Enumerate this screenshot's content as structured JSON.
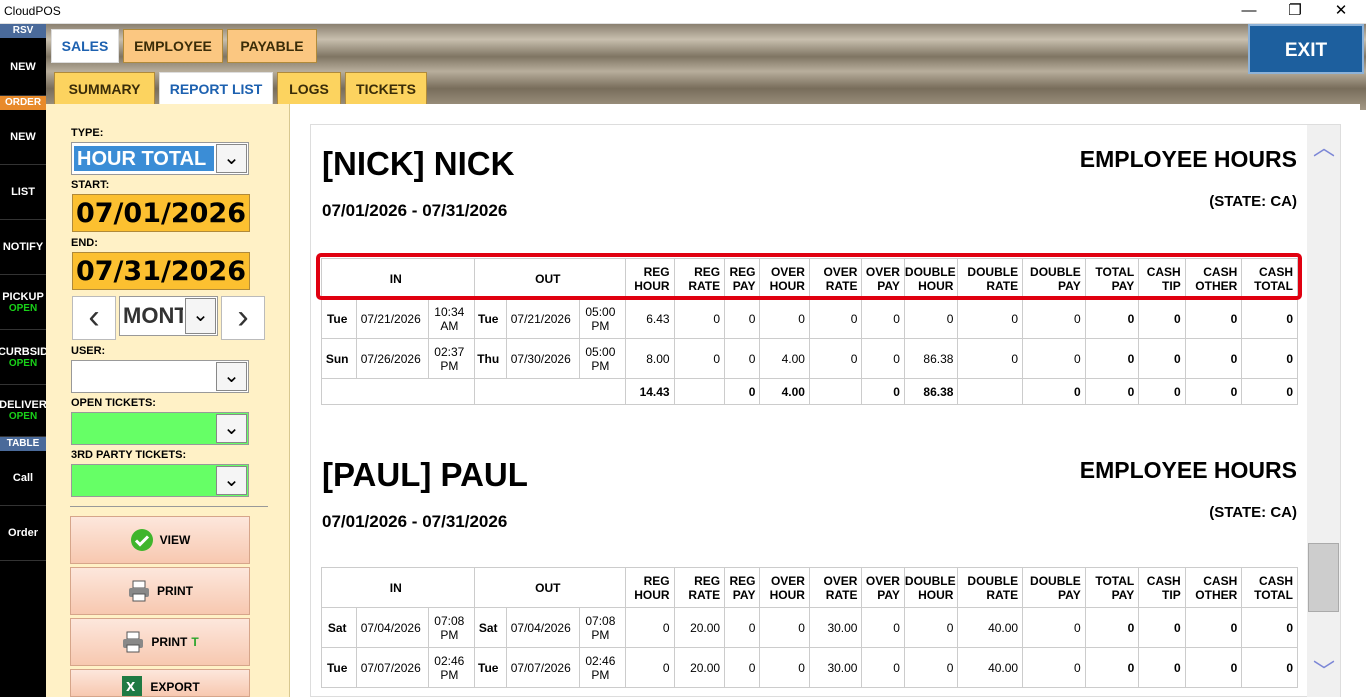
{
  "app": {
    "title": "CloudPOS"
  },
  "window_controls": {
    "minimize": "—",
    "maximize": "❐",
    "close": "✕"
  },
  "left_strip": {
    "rsv_header": "RSV",
    "order_header": "ORDER",
    "table_header": "TABLE",
    "items_top": [
      {
        "label": "NEW",
        "sub": ""
      }
    ],
    "items_mid": [
      {
        "label": "NEW",
        "sub": ""
      },
      {
        "label": "LIST",
        "sub": ""
      },
      {
        "label": "NOTIFY",
        "sub": ""
      },
      {
        "label": "PICKUP",
        "sub": "OPEN"
      },
      {
        "label": "CURBSID",
        "sub": "OPEN"
      },
      {
        "label": "DELIVER",
        "sub": "OPEN"
      }
    ],
    "items_bottom": [
      {
        "label": "Call",
        "sub": ""
      },
      {
        "label": "Order",
        "sub": ""
      }
    ]
  },
  "top_tabs": [
    "SALES",
    "EMPLOYEE",
    "PAYABLE"
  ],
  "sub_tabs": [
    "SUMMARY",
    "REPORT LIST",
    "LOGS",
    "TICKETS"
  ],
  "exit_label": "EXIT",
  "filters": {
    "type_label": "TYPE:",
    "type_value": "HOUR TOTAL",
    "start_label": "START:",
    "start_value": "07/01/2026",
    "end_label": "END:",
    "end_value": "07/31/2026",
    "period_value": "MONT",
    "user_label": "USER:",
    "open_tickets_label": "OPEN TICKETS:",
    "third_party_label": "3RD PARTY TICKETS:"
  },
  "actions": {
    "view": "VIEW",
    "print": "PRINT",
    "print_t": "PRINT",
    "print_t_suffix": "T",
    "export": "EXPORT"
  },
  "report": {
    "headers": [
      "IN",
      "OUT",
      "REG HOUR",
      "REG RATE",
      "REG PAY",
      "OVER HOUR",
      "OVER RATE",
      "OVER PAY",
      "DOUBLE HOUR",
      "DOUBLE RATE",
      "DOUBLE PAY",
      "TOTAL PAY",
      "CASH TIP",
      "CASH OTHER",
      "CASH TOTAL"
    ],
    "header_lines": [
      [
        "IN"
      ],
      [
        "OUT"
      ],
      [
        "REG",
        "HOUR"
      ],
      [
        "REG",
        "RATE"
      ],
      [
        "REG",
        "PAY"
      ],
      [
        "OVER",
        "HOUR"
      ],
      [
        "OVER",
        "RATE"
      ],
      [
        "OVER",
        "PAY"
      ],
      [
        "DOUBLE",
        "HOUR"
      ],
      [
        "DOUBLE",
        "RATE"
      ],
      [
        "DOUBLE",
        "PAY"
      ],
      [
        "TOTAL",
        "PAY"
      ],
      [
        "CASH",
        "TIP"
      ],
      [
        "CASH",
        "OTHER"
      ],
      [
        "CASH",
        "TOTAL"
      ]
    ],
    "employees": [
      {
        "name": "[NICK] NICK",
        "range": "07/01/2026 - 07/31/2026",
        "title": "EMPLOYEE HOURS",
        "state": "(STATE: CA)",
        "rows": [
          {
            "in_day": "Tue",
            "in_day_color": "purple",
            "in_date": "07/21/2026",
            "in_time": "10:34 AM",
            "out_day": "Tue",
            "out_day_color": "purple",
            "out_date": "07/21/2026",
            "out_time": "05:00 PM",
            "vals": [
              "6.43",
              "0",
              "0",
              "0",
              "0",
              "0",
              "0",
              "0",
              "0",
              "0",
              "0",
              "0",
              "0"
            ]
          },
          {
            "in_day": "Sun",
            "in_day_color": "red",
            "in_date": "07/26/2026",
            "in_time": "02:37 PM",
            "out_day": "Thu",
            "out_day_color": "purple",
            "out_date": "07/30/2026",
            "out_time": "05:00 PM",
            "vals": [
              "8.00",
              "0",
              "0",
              "4.00",
              "0",
              "0",
              "86.38",
              "0",
              "0",
              "0",
              "0",
              "0",
              "0"
            ]
          }
        ],
        "totals": [
          "14.43",
          "",
          "0",
          "4.00",
          "",
          "0",
          "86.38",
          "",
          "0",
          "0",
          "0",
          "0",
          "0"
        ]
      },
      {
        "name": "[PAUL] PAUL",
        "range": "07/01/2026 - 07/31/2026",
        "title": "EMPLOYEE HOURS",
        "state": "(STATE: CA)",
        "rows": [
          {
            "in_day": "Sat",
            "in_day_color": "blue",
            "in_date": "07/04/2026",
            "in_time": "07:08 PM",
            "out_day": "Sat",
            "out_day_color": "blue",
            "out_date": "07/04/2026",
            "out_time": "07:08 PM",
            "vals": [
              "0",
              "20.00",
              "0",
              "0",
              "30.00",
              "0",
              "0",
              "40.00",
              "0",
              "0",
              "0",
              "0",
              "0"
            ]
          },
          {
            "in_day": "Tue",
            "in_day_color": "purple",
            "in_date": "07/07/2026",
            "in_time": "02:46 PM",
            "out_day": "Tue",
            "out_day_color": "purple",
            "out_date": "07/07/2026",
            "out_time": "02:46 PM",
            "vals": [
              "0",
              "20.00",
              "0",
              "0",
              "30.00",
              "0",
              "0",
              "40.00",
              "0",
              "0",
              "0",
              "0",
              "0"
            ]
          }
        ],
        "totals": []
      }
    ]
  }
}
